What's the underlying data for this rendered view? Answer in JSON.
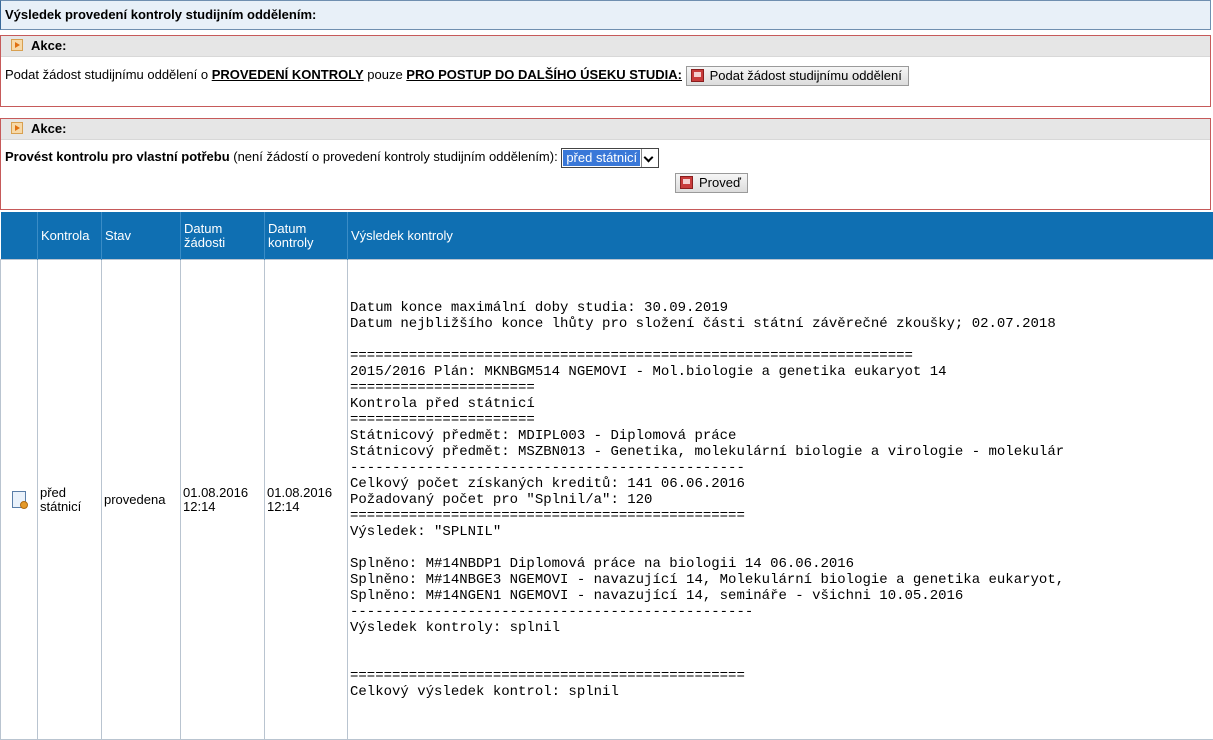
{
  "header": {
    "title": "Výsledek provedení kontroly studijním oddělením:"
  },
  "akce1": {
    "title": "Akce:",
    "text_prefix": "Podat žádost studijnímu oddělení o ",
    "link_kontroly": "PROVEDENÍ KONTROLY",
    "text_middle": " pouze ",
    "link_postup": "PRO POSTUP DO DALŠÍHO ÚSEKU STUDIA:",
    "button_label": "Podat žádost studijnímu oddělení"
  },
  "akce2": {
    "title": "Akce:",
    "label_bold": "Provést kontrolu pro vlastní potřebu",
    "label_rest": " (není žádostí o provedení kontroly studijním oddělením): ",
    "select_value": "před státnicí",
    "button_label": "Proveď"
  },
  "table": {
    "columns": {
      "kontrola": "Kontrola",
      "stav": "Stav",
      "datum_zadosti_1": "Datum",
      "datum_zadosti_2": "žádosti",
      "datum_kontroly_1": "Datum",
      "datum_kontroly_2": "kontroly",
      "vysledek": "Výsledek kontroly"
    },
    "row": {
      "icon": "document-icon",
      "kontrola_1": "před",
      "kontrola_2": "státnicí",
      "stav": "provedena",
      "datum_zadosti_date": "01.08.2016",
      "datum_zadosti_time": "12:14",
      "datum_kontroly_date": "01.08.2016",
      "datum_kontroly_time": "12:14",
      "vysledek": "Datum konce maximální doby studia: 30.09.2019\nDatum nejbližšího konce lhůty pro složení části státní závěrečné zkoušky; 02.07.2018\n\n===================================================================\n2015/2016 Plán: MKNBGM514 NGEMOVI - Mol.biologie a genetika eukaryot 14\n======================\nKontrola před státnicí\n======================\nStátnicový předmět: MDIPL003 - Diplomová práce\nStátnicový předmět: MSZBN013 - Genetika, molekulární biologie a virologie - molekulár\n-----------------------------------------------\nCelkový počet získaných kreditů: 141 06.06.2016\nPožadovaný počet pro \"Splnil/a\": 120\n===============================================\nVýsledek: \"SPLNIL\"\n\nSplněno: M#14NBDP1 Diplomová práce na biologii 14 06.06.2016\nSplněno: M#14NBGE3 NGEMOVI - navazující 14, Molekulární biologie a genetika eukaryot,\nSplněno: M#14NGEN1 NGEMOVI - navazující 14, semináře - všichni 10.05.2016\n------------------------------------------------\nVýsledek kontroly: splnil\n\n\n===============================================\nCelkový výsledek kontrol: splnil"
    }
  }
}
